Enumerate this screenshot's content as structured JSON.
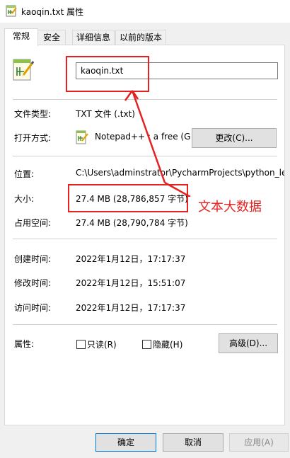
{
  "window": {
    "title": "kaoqin.txt 属性",
    "icon": "notepad-plus-plus-icon"
  },
  "tabs": [
    {
      "label": "常规",
      "active": true
    },
    {
      "label": "安全",
      "active": false
    },
    {
      "label": "详细信息",
      "active": false
    },
    {
      "label": "以前的版本",
      "active": false
    }
  ],
  "general": {
    "file_name": "kaoqin.txt",
    "file_type_label": "文件类型:",
    "file_type_value": "TXT 文件 (.txt)",
    "opens_with_label": "打开方式:",
    "opens_with_value": "Notepad++ : a free (G",
    "change_button": "更改(C)...",
    "location_label": "位置:",
    "location_value": "C:\\Users\\adminstrator\\PycharmProjects\\python_le",
    "size_label": "大小:",
    "size_value": "27.4 MB (28,786,857 字节)",
    "size_on_disk_label": "占用空间:",
    "size_on_disk_value": "27.4 MB (28,790,784 字节)",
    "created_label": "创建时间:",
    "created_value": "2022年1月12日，17:17:37",
    "modified_label": "修改时间:",
    "modified_value": "2022年1月12日，15:51:07",
    "accessed_label": "访问时间:",
    "accessed_value": "2022年1月12日，17:17:37",
    "attributes_label": "属性:",
    "readonly_label": "只读(R)",
    "readonly_checked": false,
    "hidden_label": "隐藏(H)",
    "hidden_checked": false,
    "advanced_button": "高级(D)..."
  },
  "annotation": {
    "text": "文本大数据",
    "color": "#e52222"
  },
  "footer": {
    "ok_button": "确定",
    "cancel_button": "取消",
    "apply_button": "应用(A)"
  }
}
